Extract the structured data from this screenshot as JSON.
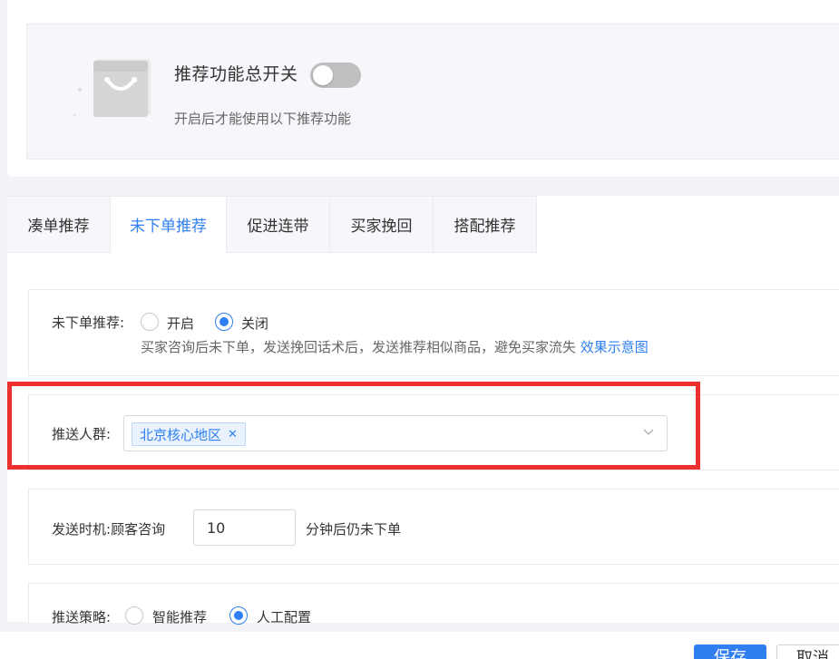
{
  "header": {
    "switch_title": "推荐功能总开关",
    "switch_on": false,
    "switch_desc": "开启后才能使用以下推荐功能"
  },
  "tabs": [
    {
      "label": "凑单推荐",
      "active": false
    },
    {
      "label": "未下单推荐",
      "active": true
    },
    {
      "label": "促进连带",
      "active": false
    },
    {
      "label": "买家挽回",
      "active": false
    },
    {
      "label": "搭配推荐",
      "active": false
    }
  ],
  "settings": {
    "recommend_label": "未下单推荐:",
    "recommend_options": {
      "on": "开启",
      "off": "关闭"
    },
    "recommend_selected": "关闭",
    "recommend_hint": "买家咨询后未下单，发送挽回话术后，发送推荐相似商品，避免买家流失",
    "effect_link": "效果示意图",
    "audience_label": "推送人群:",
    "audience_tag": "北京核心地区",
    "timing_label": "发送时机:",
    "timing_prefix": "顾客咨询",
    "timing_value": "10",
    "timing_suffix": "分钟后仍未下单",
    "strategy_label": "推送策略:",
    "strategy_options": {
      "smart": "智能推荐",
      "manual": "人工配置"
    },
    "strategy_selected": "人工配置"
  },
  "footer": {
    "save": "保存",
    "cancel": "取消"
  },
  "colors": {
    "accent": "#2f7ff1",
    "highlight": "#ec2f2f"
  }
}
